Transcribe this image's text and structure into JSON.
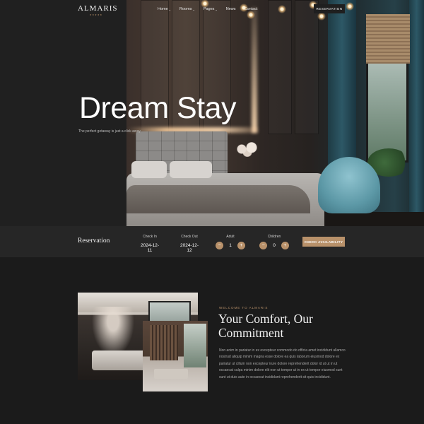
{
  "brand": {
    "logo": "ALMARIS",
    "logo_stars": "★★★★★"
  },
  "nav": {
    "items": [
      {
        "label": "Home",
        "has_dropdown": true
      },
      {
        "label": "Rooms",
        "has_dropdown": true
      },
      {
        "label": "Pages",
        "has_dropdown": true
      },
      {
        "label": "News",
        "has_dropdown": false
      },
      {
        "label": "Contact",
        "has_dropdown": false
      }
    ],
    "cta": "RESERVATION"
  },
  "hero": {
    "title": "Dream Stay",
    "subtitle": "The perfect getaway is just a click away"
  },
  "reservation": {
    "label": "Reservation",
    "check_in": {
      "label": "Check In",
      "value": "2024-12-11"
    },
    "check_out": {
      "label": "Check Out",
      "value": "2024-12-12"
    },
    "adult": {
      "label": "Adult",
      "value": "1",
      "minus": "−",
      "plus": "+"
    },
    "children": {
      "label": "Children",
      "value": "0",
      "minus": "−",
      "plus": "+"
    },
    "button": "CHECK AVAILABILITY"
  },
  "welcome": {
    "eyebrow": "WELCOME TO ALMARIS",
    "title": "Your Comfort, Our Commitment",
    "text": "Non anim in pariatur in ex excepteur commodo do officia amet incididunt ullamco nostrud aliquip minim magna esse dolore ea quis laborum eiusmod dolore ex pariatur ut cillum non excepteur irure dolore reprehenderit dolor id ut ut in ut occaecat culpa minim dolore elit non ut tempor ut in ex ut tempor eiusmod sunt sunt ut duis aute in occaecat incididunt reprehenderit sit quis incididunt."
  },
  "colors": {
    "accent": "#b8916a",
    "background": "#1b1b1b",
    "bar": "#262626"
  }
}
